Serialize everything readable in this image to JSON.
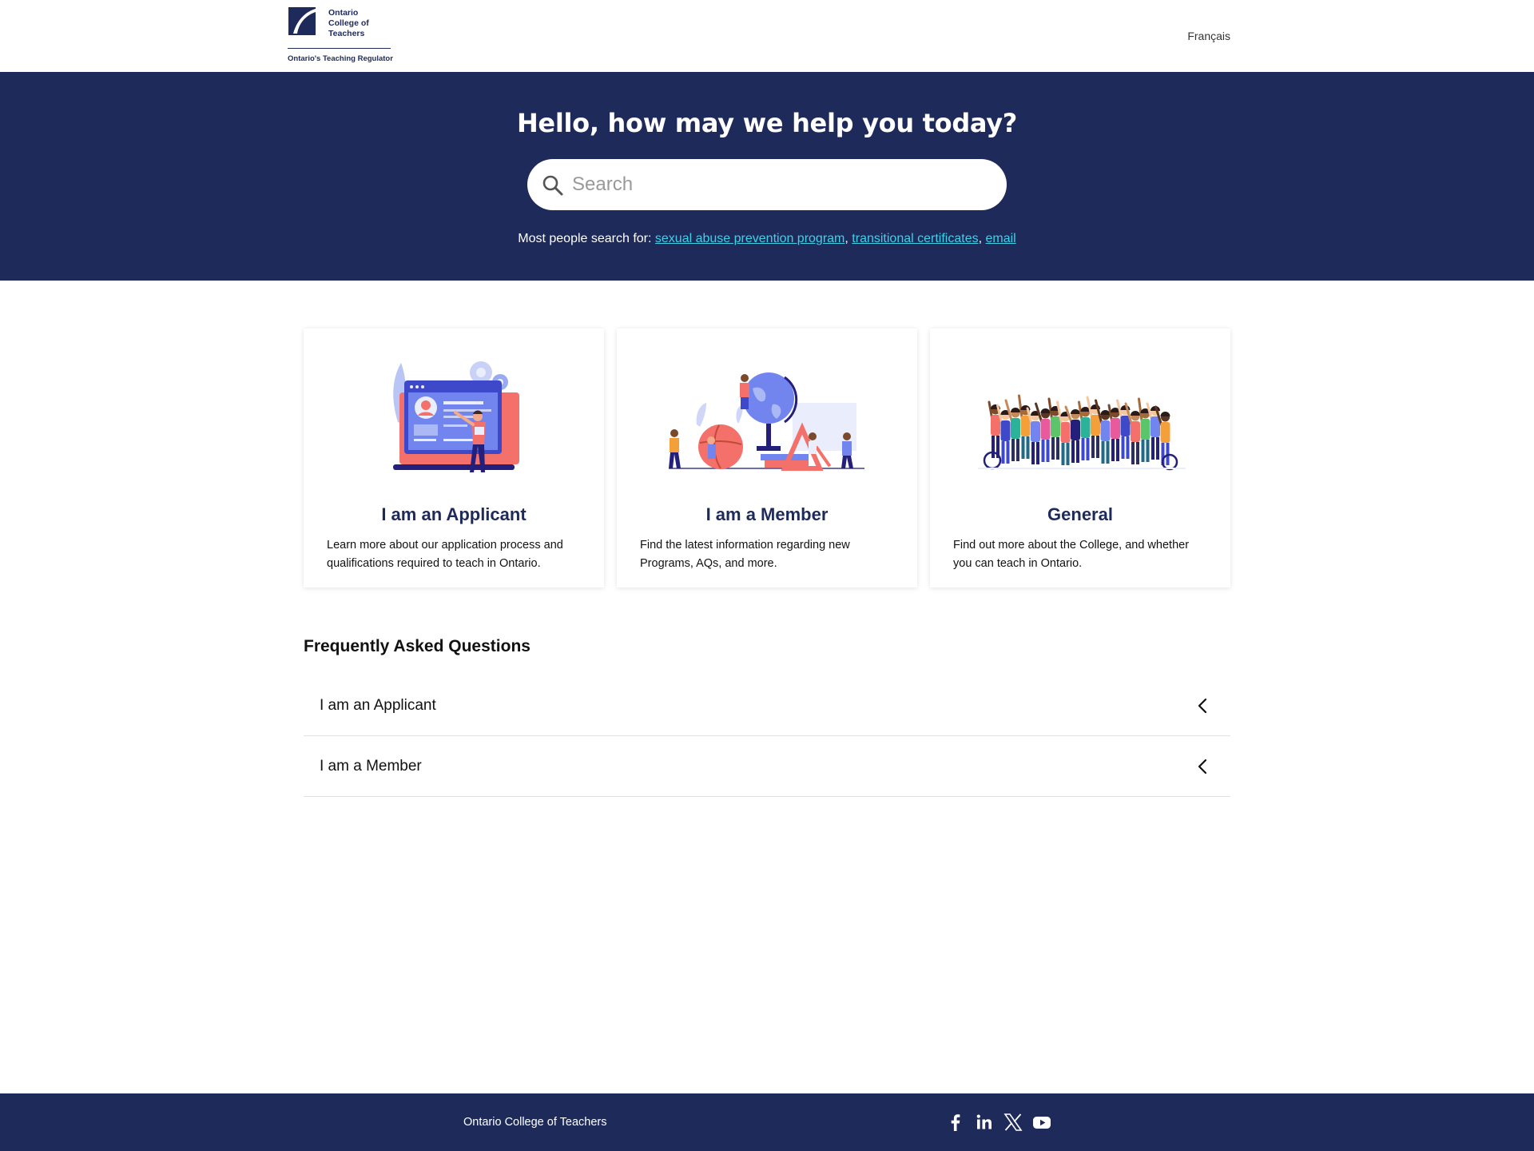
{
  "header": {
    "logo_text_line1": "Ontario",
    "logo_text_line2": "College of",
    "logo_text_line3": "Teachers",
    "logo_tagline": "Ontario's Teaching Regulator",
    "language_link": "Français"
  },
  "hero": {
    "title": "Hello, how may we help you today?",
    "search_placeholder": "Search",
    "popular_prefix": "Most people search for:",
    "popular_links": [
      "sexual abuse prevention program",
      "transitional certificates",
      "email"
    ],
    "separator": ","
  },
  "cards": [
    {
      "title": "I am an Applicant",
      "description": "Learn more about our application process and qualifications required to teach in Ontario.",
      "icon": "applicant-illustration"
    },
    {
      "title": "I am a Member",
      "description": "Find the latest information regarding new Programs, AQs, and more.",
      "icon": "member-illustration"
    },
    {
      "title": "General",
      "description": "Find out more about the College, and whether you can teach in Ontario.",
      "icon": "general-illustration"
    }
  ],
  "faq": {
    "title": "Frequently Asked Questions",
    "items": [
      {
        "label": "I am an Applicant"
      },
      {
        "label": "I am a Member"
      }
    ]
  },
  "footer": {
    "org_name": "Ontario College of Teachers",
    "socials": [
      "facebook-icon",
      "linkedin-icon",
      "x-icon",
      "youtube-icon"
    ]
  },
  "colors": {
    "brand_navy": "#1e2a5a",
    "link_cyan": "#3ed1e8",
    "accent_coral": "#f06a4f",
    "accent_blue": "#5a6cf0"
  }
}
